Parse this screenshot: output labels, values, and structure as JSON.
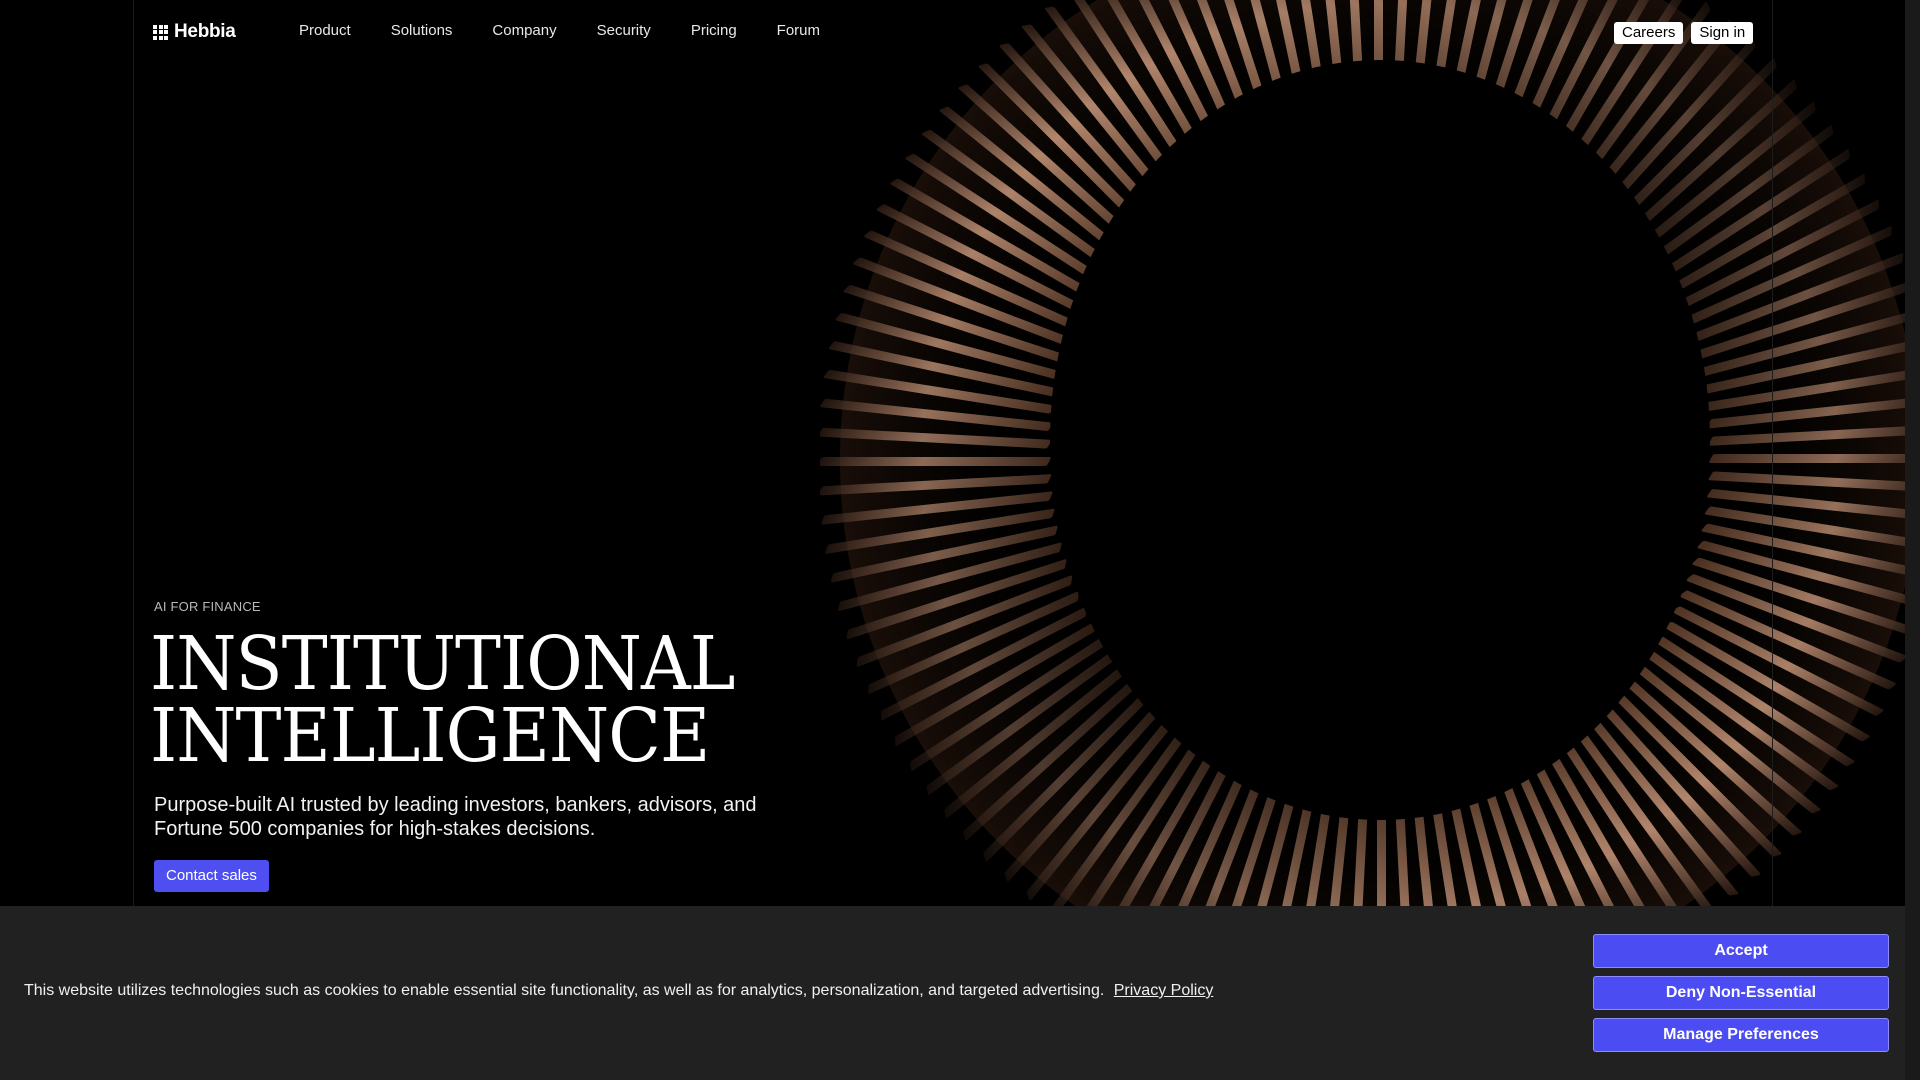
{
  "nav": {
    "logo_text": "Hebbia",
    "links": [
      "Product",
      "Solutions",
      "Company",
      "Security",
      "Pricing",
      "Forum"
    ],
    "careers_label": "Careers",
    "signin_label": "Sign in"
  },
  "hero": {
    "eyebrow": "AI FOR FINANCE",
    "headline_line1": "INSTITUTIONAL",
    "headline_line2": "INTELLIGENCE",
    "subhead": "Purpose-built AI trusted by leading investors, bankers, advisors, and Fortune 500 companies for high-stakes decisions.",
    "cta_label": "Contact sales",
    "cta_color": "#4f4ff1"
  },
  "cookie_banner": {
    "text": "This website utilizes technologies such as cookies to enable essential site functionality, as well as for analytics, personalization, and targeted advertising.",
    "policy_link": "Privacy Policy",
    "accept_label": "Accept",
    "deny_label": "Deny Non-Essential",
    "manage_label": "Manage Preferences",
    "button_color": "#4c4cf3"
  },
  "icons": {
    "logo": "grid-logo-icon"
  }
}
